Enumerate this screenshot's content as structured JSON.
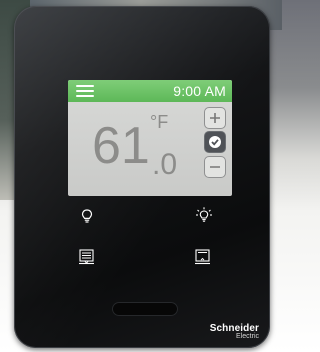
{
  "screen": {
    "time": "9:00 AM",
    "temperature_integer": "61",
    "temperature_decimal": ".0",
    "unit": "°F",
    "accent_color": "#5db858"
  },
  "controls": {
    "increase_icon": "plus-icon",
    "confirm_icon": "check-circle-icon",
    "decrease_icon": "minus-icon"
  },
  "touch_keys": [
    {
      "icon": "light-bulb-off-icon"
    },
    {
      "icon": "light-bulb-on-icon"
    },
    {
      "icon": "blinds-down-icon"
    },
    {
      "icon": "blinds-up-icon"
    }
  ],
  "brand": {
    "name": "Schneider",
    "sub": "Electric"
  }
}
